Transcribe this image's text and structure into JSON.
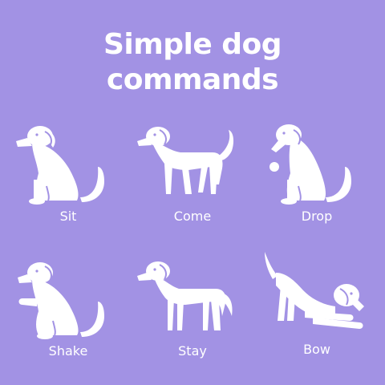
{
  "title": {
    "line1": "Simple dog",
    "line2": "commands"
  },
  "colors": {
    "background": "#a292e4",
    "foreground": "#ffffff"
  },
  "commands": [
    {
      "label": "Sit",
      "icon": "dog-sitting-icon"
    },
    {
      "label": "Come",
      "icon": "dog-walking-icon"
    },
    {
      "label": "Drop",
      "icon": "dog-drop-ball-icon"
    },
    {
      "label": "Shake",
      "icon": "dog-shake-paw-icon"
    },
    {
      "label": "Stay",
      "icon": "dog-standing-icon"
    },
    {
      "label": "Bow",
      "icon": "dog-bow-icon"
    }
  ]
}
